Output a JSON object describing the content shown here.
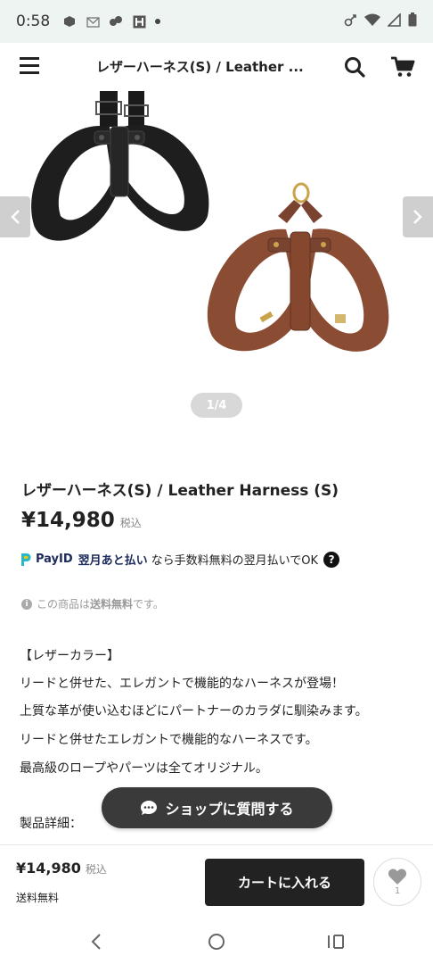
{
  "status_bar": {
    "time": "0:58"
  },
  "header": {
    "title": "レザーハーネス(S) / Leather ...",
    "menu_icon": "hamburger-icon",
    "search_icon": "search-icon",
    "cart_icon": "cart-icon"
  },
  "carousel": {
    "pager": "1/4",
    "prev_icon": "chevron-left-icon",
    "next_icon": "chevron-right-icon",
    "colors": {
      "black_harness": "#1e1e1e",
      "brown_harness": "#8a4d33",
      "hardware": "#c9a44a"
    }
  },
  "product": {
    "title": "レザーハーネス(S) / Leather Harness (S)",
    "price": "¥14,980",
    "tax_label": "税込",
    "payid": {
      "brand": "PayID",
      "service": "翌月あと払い",
      "text": "なら手数料無料の翌月払いでOK"
    },
    "shipping_note": {
      "prefix": "この商品は",
      "emphasis": "送料無料",
      "suffix": "です。"
    },
    "description": [
      "【レザーカラー】",
      "リードと併せた、エレガントで機能的なハーネスが登場！",
      "上質な革が使い込むほどにパートナーのカラダに馴染みます。",
      "リードと併せたエレガントで機能的なハーネスです。",
      "最高級のロープやパーツは全てオリジナル。",
      "製品詳細："
    ]
  },
  "chat_button": {
    "label": "ショップに質問する"
  },
  "bottom_bar": {
    "price": "¥14,980",
    "tax_label": "税込",
    "shipping": "送料無料",
    "add_to_cart": "カートに入れる",
    "favorite_count": "1"
  },
  "colors": {
    "accent": "#222222",
    "status_bar_bg": "#eef4f1",
    "muted": "#999999"
  }
}
